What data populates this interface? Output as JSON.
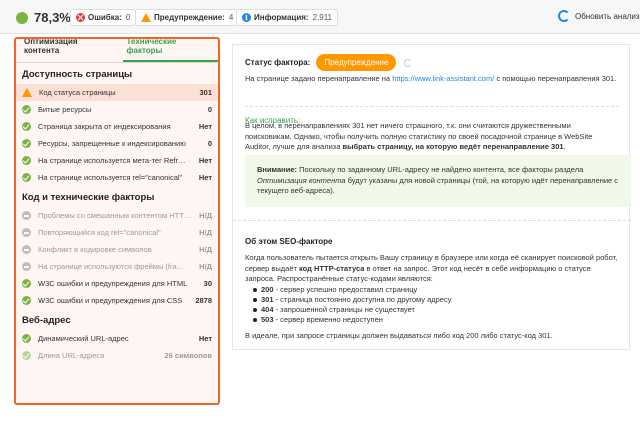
{
  "topbar": {
    "score": "78,3%",
    "errors": {
      "label": "Ошибка:",
      "count": "0"
    },
    "warnings": {
      "label": "Предупреждение:",
      "count": "4"
    },
    "info": {
      "label": "Информация:",
      "count": "2,911"
    },
    "refresh_label": "Обновить анализ"
  },
  "left_panel": {
    "tabs": [
      "Оптимизация контента",
      "Технические факторы"
    ],
    "sections": [
      {
        "title": "Доступность страницы",
        "items": [
          {
            "name": "Код статуса страницы",
            "value": "301",
            "status": "warn",
            "highlight": true
          },
          {
            "name": "Битые ресурсы",
            "value": "0",
            "status": "ok"
          },
          {
            "name": "Страница закрыта от индексирования",
            "value": "Нет",
            "status": "ok"
          },
          {
            "name": "Ресурсы, запрещенные к индексированию",
            "value": "0",
            "status": "ok"
          },
          {
            "name": "На странице используется мета-тег Refr…",
            "value": "Нет",
            "status": "ok"
          },
          {
            "name": "На странице используется rel=\"canonical\"",
            "value": "Нет",
            "status": "ok"
          }
        ]
      },
      {
        "title": "Код и технические факторы",
        "items": [
          {
            "name": "Проблемы со смешанным контентом HTTP/…",
            "value": "Н/Д",
            "status": "na"
          },
          {
            "name": "Повторяющийся код rel=\"canonical\"",
            "value": "Н/Д",
            "status": "na"
          },
          {
            "name": "Конфликт в кодировке символов",
            "value": "Н/Д",
            "status": "na"
          },
          {
            "name": "На странице используются фреймы (fra…",
            "value": "Н/Д",
            "status": "na"
          },
          {
            "name": "W3C ошибки и предупреждения для HTML",
            "value": "30",
            "status": "ok"
          },
          {
            "name": "W3C ошибки и предупреждения для CSS",
            "value": "2878",
            "status": "ok"
          }
        ]
      },
      {
        "title": "Веб-адрес",
        "items": [
          {
            "name": "Динамический URL-адрес",
            "value": "Нет",
            "status": "ok"
          },
          {
            "name": "Длина URL-адреса",
            "value": "26 символов",
            "status": "ok-light"
          }
        ]
      }
    ]
  },
  "detail": {
    "status_label": "Статус фактора:",
    "status_value": "Предупреждение",
    "intro_1": "На странице задано перенаправление на ",
    "intro_link": "https://www.link-assistant.com/",
    "intro_2": " с помощью перенаправления 301.",
    "howfix_title": "Как исправить:",
    "fix_text_1": "В целом, в перенаправлениях 301 нет ничего страшного, т.к. они считаются дружественными поисковикам. Однако, чтобы получить полную статистику по своей посадочной странице в WebSite Auditor, лучше для анализа ",
    "fix_text_bold": "выбрать страницу, на которую ведёт перенаправление 301",
    "fix_text_2": ".",
    "note_bold": "Внимание:",
    "note_text_1": " Поскольку по заданному URL-адресу не найдено контента, все факторы раздела ",
    "note_italic": "Оптимизация контента",
    "note_text_2": " будут указаны для новой страницы (той, на которую идёт перенаправление с текущего веб-адреса).",
    "about_title": "Об этом SEO-факторе",
    "about_text_1": "Когда пользователь пытается открыть Вашу страницу в браузере или когда её сканирует поисковой робот, сервер выдаёт ",
    "about_bold": "код HTTP-статуса",
    "about_text_2": " в ответ на запрос. Этот код несёт в себе информацию о статусе запроса. Распространённые статус-кодами являются:",
    "bullets": [
      {
        "code": "200",
        "text": " - сервер успешно предоставил страницу"
      },
      {
        "code": "301",
        "text": " - страница постоянно доступна по другому адресу"
      },
      {
        "code": "404",
        "text": " - запрошенной страницы не существует"
      },
      {
        "code": "503",
        "text": " - сервер временно недоступен"
      }
    ],
    "ideal_text": "В идеале, при запросе страницы должен выдаваться либо код 200 либо статус-код 301."
  },
  "colors": {
    "accent_orange": "#f26522",
    "ok_green": "#7cb342",
    "warn_orange": "#ff9800",
    "error_red": "#e53935",
    "info_blue": "#1e88e5"
  }
}
